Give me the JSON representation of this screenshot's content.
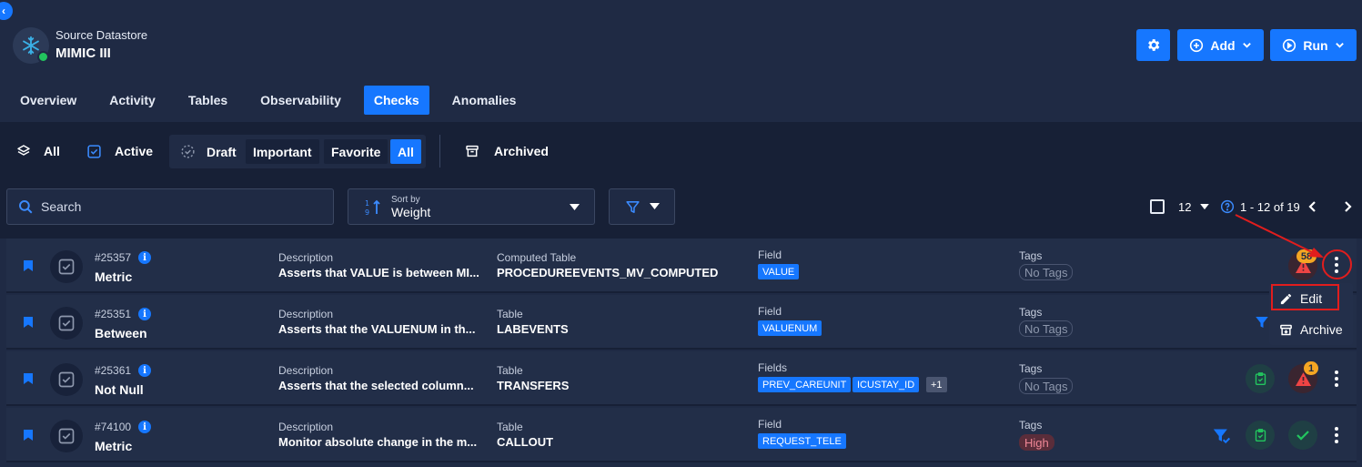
{
  "datastore": {
    "subtitle": "Source Datastore",
    "name": "MIMIC III"
  },
  "toolbar": {
    "settings_icon": "gear-icon",
    "add_label": "Add",
    "run_label": "Run"
  },
  "tabs": [
    {
      "label": "Overview",
      "active": false
    },
    {
      "label": "Activity",
      "active": false
    },
    {
      "label": "Tables",
      "active": false
    },
    {
      "label": "Observability",
      "active": false
    },
    {
      "label": "Checks",
      "active": true
    },
    {
      "label": "Anomalies",
      "active": false
    }
  ],
  "status_filters": {
    "all": "All",
    "active": "Active",
    "draft": "Draft",
    "important": "Important",
    "favorite": "Favorite",
    "all_chip": "All",
    "archived": "Archived"
  },
  "search": {
    "placeholder": "Search"
  },
  "sort": {
    "caption": "Sort by",
    "value": "Weight"
  },
  "pagination": {
    "page_size": "12",
    "range": "1 - 12 of 19"
  },
  "checks": [
    {
      "id": "#25357",
      "type": "Metric",
      "desc_label": "Description",
      "description": "Asserts that VALUE is between MI...",
      "table_label": "Computed Table",
      "table": "PROCEDUREEVENTS_MV_COMPUTED",
      "field_label": "Field",
      "fields": [
        "VALUE"
      ],
      "extra": "",
      "tags_label": "Tags",
      "tag": "No Tags",
      "anomaly_count": "58"
    },
    {
      "id": "#25351",
      "type": "Between",
      "desc_label": "Description",
      "description": "Asserts that the VALUENUM in th...",
      "table_label": "Table",
      "table": "LABEVENTS",
      "field_label": "Field",
      "fields": [
        "VALUENUM"
      ],
      "extra": "",
      "tags_label": "Tags",
      "tag": "No Tags",
      "anomaly_count": ""
    },
    {
      "id": "#25361",
      "type": "Not Null",
      "desc_label": "Description",
      "description": "Asserts that the selected column...",
      "table_label": "Table",
      "table": "TRANSFERS",
      "field_label": "Fields",
      "fields": [
        "PREV_CAREUNIT",
        "ICUSTAY_ID"
      ],
      "extra": "+1",
      "tags_label": "Tags",
      "tag": "No Tags",
      "anomaly_count": "1"
    },
    {
      "id": "#74100",
      "type": "Metric",
      "desc_label": "Description",
      "description": "Monitor absolute change in the m...",
      "table_label": "Table",
      "table": "CALLOUT",
      "field_label": "Field",
      "fields": [
        "REQUEST_TELE"
      ],
      "extra": "",
      "tags_label": "Tags",
      "tag": "High",
      "anomaly_count": ""
    }
  ],
  "context_menu": {
    "edit": "Edit",
    "archive": "Archive"
  },
  "colors": {
    "accent": "#1677ff",
    "background": "#1f2a44",
    "highlight": "#e11d1d",
    "warning": "#f5a623",
    "success": "#22c55e"
  }
}
